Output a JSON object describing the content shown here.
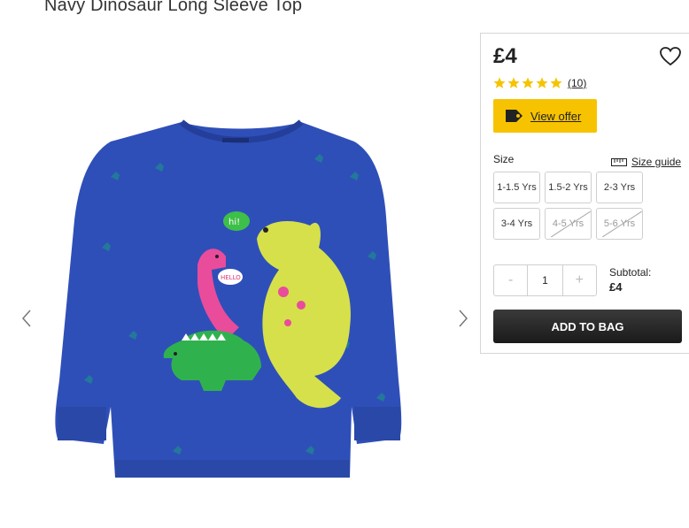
{
  "product": {
    "title": "Navy Dinosaur Long Sleeve Top",
    "price": "£4",
    "rating": 5,
    "review_count": "(10)",
    "offer_label": "View offer",
    "image_icon": "product-photo",
    "speech_bubble_1": "hi!",
    "speech_bubble_2": "HELLO"
  },
  "gallery": {
    "prev_icon": "chevron-left-icon",
    "next_icon": "chevron-right-icon"
  },
  "size": {
    "label": "Size",
    "guide_label": "Size guide",
    "options": [
      {
        "label": "1-1.5 Yrs",
        "available": true
      },
      {
        "label": "1.5-2 Yrs",
        "available": true
      },
      {
        "label": "2-3 Yrs",
        "available": true
      },
      {
        "label": "3-4 Yrs",
        "available": true
      },
      {
        "label": "4-5 Yrs",
        "available": false
      },
      {
        "label": "5-6 Yrs",
        "available": false
      }
    ]
  },
  "quantity": {
    "minus": "-",
    "value": "1",
    "plus": "+"
  },
  "subtotal": {
    "label": "Subtotal:",
    "value": "£4"
  },
  "add_to_bag_label": "ADD TO BAG",
  "colors": {
    "offer_yellow": "#f7c300",
    "star_yellow": "#f5c400",
    "button_dark": "#222222",
    "shirt_blue": "#2f4fb8"
  }
}
